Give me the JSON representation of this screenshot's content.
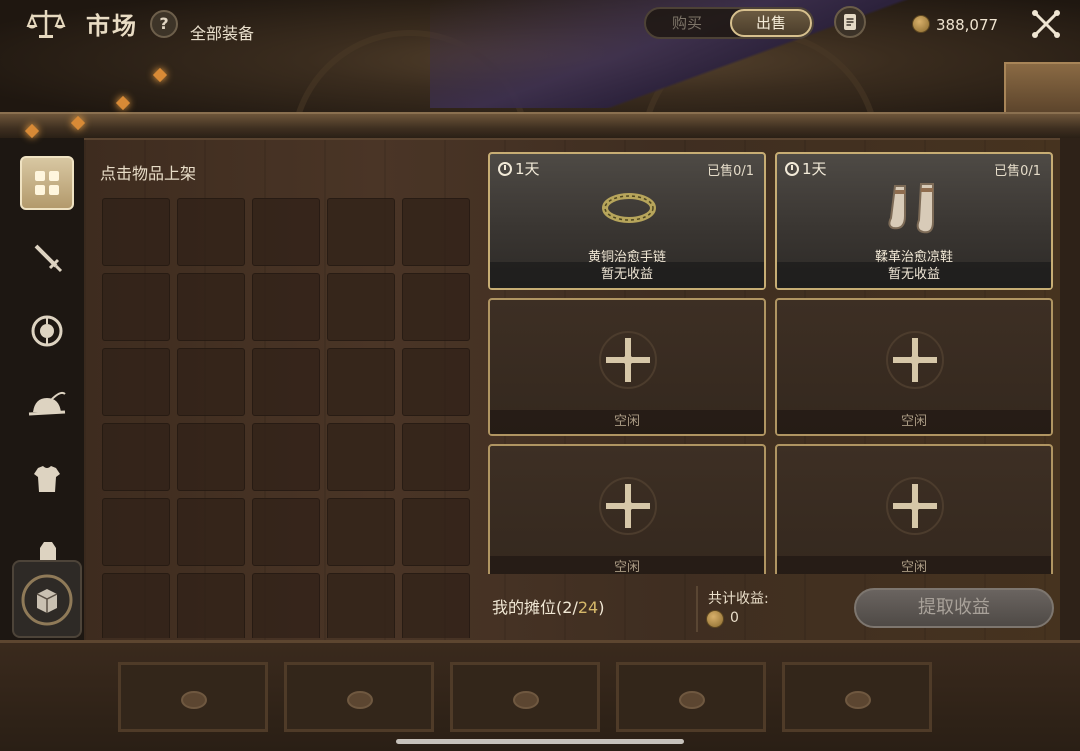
{
  "header": {
    "title": "市场",
    "help_label": "?",
    "subtitle": "全部装备",
    "tabs": [
      {
        "label": "购买",
        "active": false
      },
      {
        "label": "出售",
        "active": true
      }
    ],
    "currency_icon": "coin-icon",
    "currency_value": "388,077",
    "close_icon": "close-icon",
    "record_icon": "document-icon"
  },
  "sidebar": {
    "items": [
      {
        "name": "all-items",
        "icon": "grid-icon",
        "active": true
      },
      {
        "name": "weapons",
        "icon": "sword-icon",
        "active": false
      },
      {
        "name": "shields",
        "icon": "shield-icon",
        "active": false
      },
      {
        "name": "headgear",
        "icon": "hat-icon",
        "active": false
      },
      {
        "name": "armor",
        "icon": "armor-icon",
        "active": false
      },
      {
        "name": "gloves",
        "icon": "gauntlet-icon",
        "active": false
      }
    ],
    "bottom_icon": "crate-icon"
  },
  "inventory": {
    "title": "点击物品上架",
    "columns": 5,
    "rows": 6
  },
  "slots": [
    {
      "type": "filled",
      "timer": "1天",
      "sold": "已售0/1",
      "item_name": "黄铜治愈手链",
      "item_icon": "bracelet-icon",
      "income": "暂无收益"
    },
    {
      "type": "filled",
      "timer": "1天",
      "sold": "已售0/1",
      "item_name": "鞣革治愈凉鞋",
      "item_icon": "sandals-icon",
      "income": "暂无收益"
    },
    {
      "type": "empty",
      "label": "空闲"
    },
    {
      "type": "empty",
      "label": "空闲"
    },
    {
      "type": "empty",
      "label": "空闲"
    },
    {
      "type": "empty",
      "label": "空闲"
    }
  ],
  "footer": {
    "stall_prefix": "我的摊位(",
    "stall_used": "2",
    "stall_sep": "/",
    "stall_total": "24",
    "stall_suffix": ")",
    "total_label": "共计收益:",
    "total_value": "0",
    "claim_label": "提取收益"
  },
  "colors": {
    "accent_gold": "#c7ad74",
    "wood": "#4a3526",
    "active_tab": "#d7c08e"
  }
}
